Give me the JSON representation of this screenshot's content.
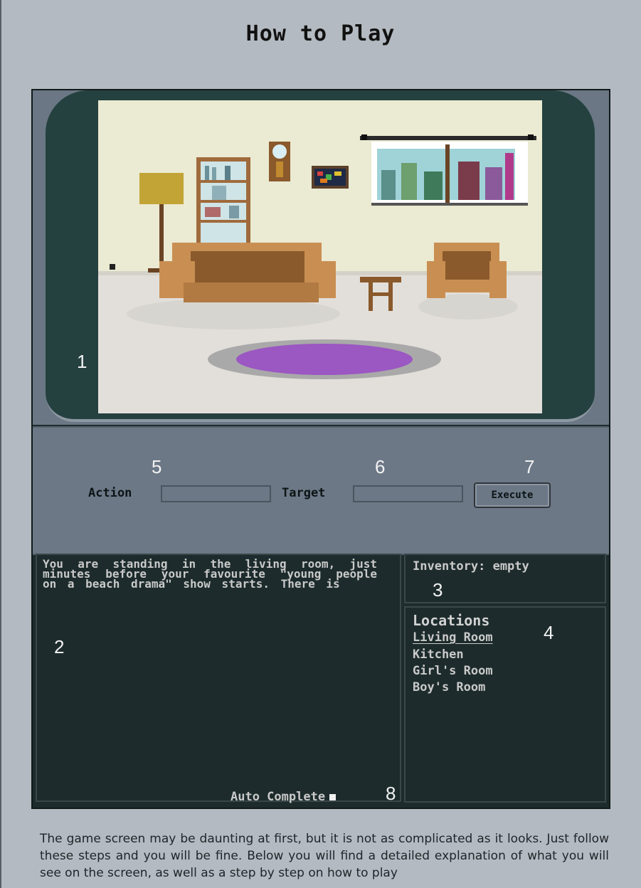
{
  "page": {
    "title": "How to Play",
    "description": "The game screen may be daunting at first, but it is not as complicated as it looks. Just follow these steps and you will be fine. Below you will find a detailed explanation of what you will see on the screen, as well as a step by step on how to play"
  },
  "callouts": {
    "scene": "1",
    "narration": "2",
    "inventory": "3",
    "locations": "4",
    "action": "5",
    "target": "6",
    "execute": "7",
    "autocomplete": "8"
  },
  "controls": {
    "action_label": "Action",
    "action_value": "",
    "target_label": "Target",
    "target_value": "",
    "execute_label": "Execute"
  },
  "narration": {
    "text": "You are standing in the living room, just minutes before your favourite \"young people on a beach drama\" show starts. There is",
    "autocomplete_label": "Auto Complete"
  },
  "inventory": {
    "text": "Inventory: empty"
  },
  "locations": {
    "title": "Locations",
    "items": [
      {
        "label": "Living Room",
        "active": true
      },
      {
        "label": "Kitchen",
        "active": false
      },
      {
        "label": "Girl's Room",
        "active": false
      },
      {
        "label": "Boy's Room",
        "active": false
      }
    ]
  },
  "colors": {
    "page_bg": "#b4bac1",
    "tv_frame": "#244140",
    "panel_bg": "#6c7886",
    "text_panel_bg": "#1d2b2c",
    "rug": "#9b57c2",
    "sofa": "#c98f52"
  }
}
